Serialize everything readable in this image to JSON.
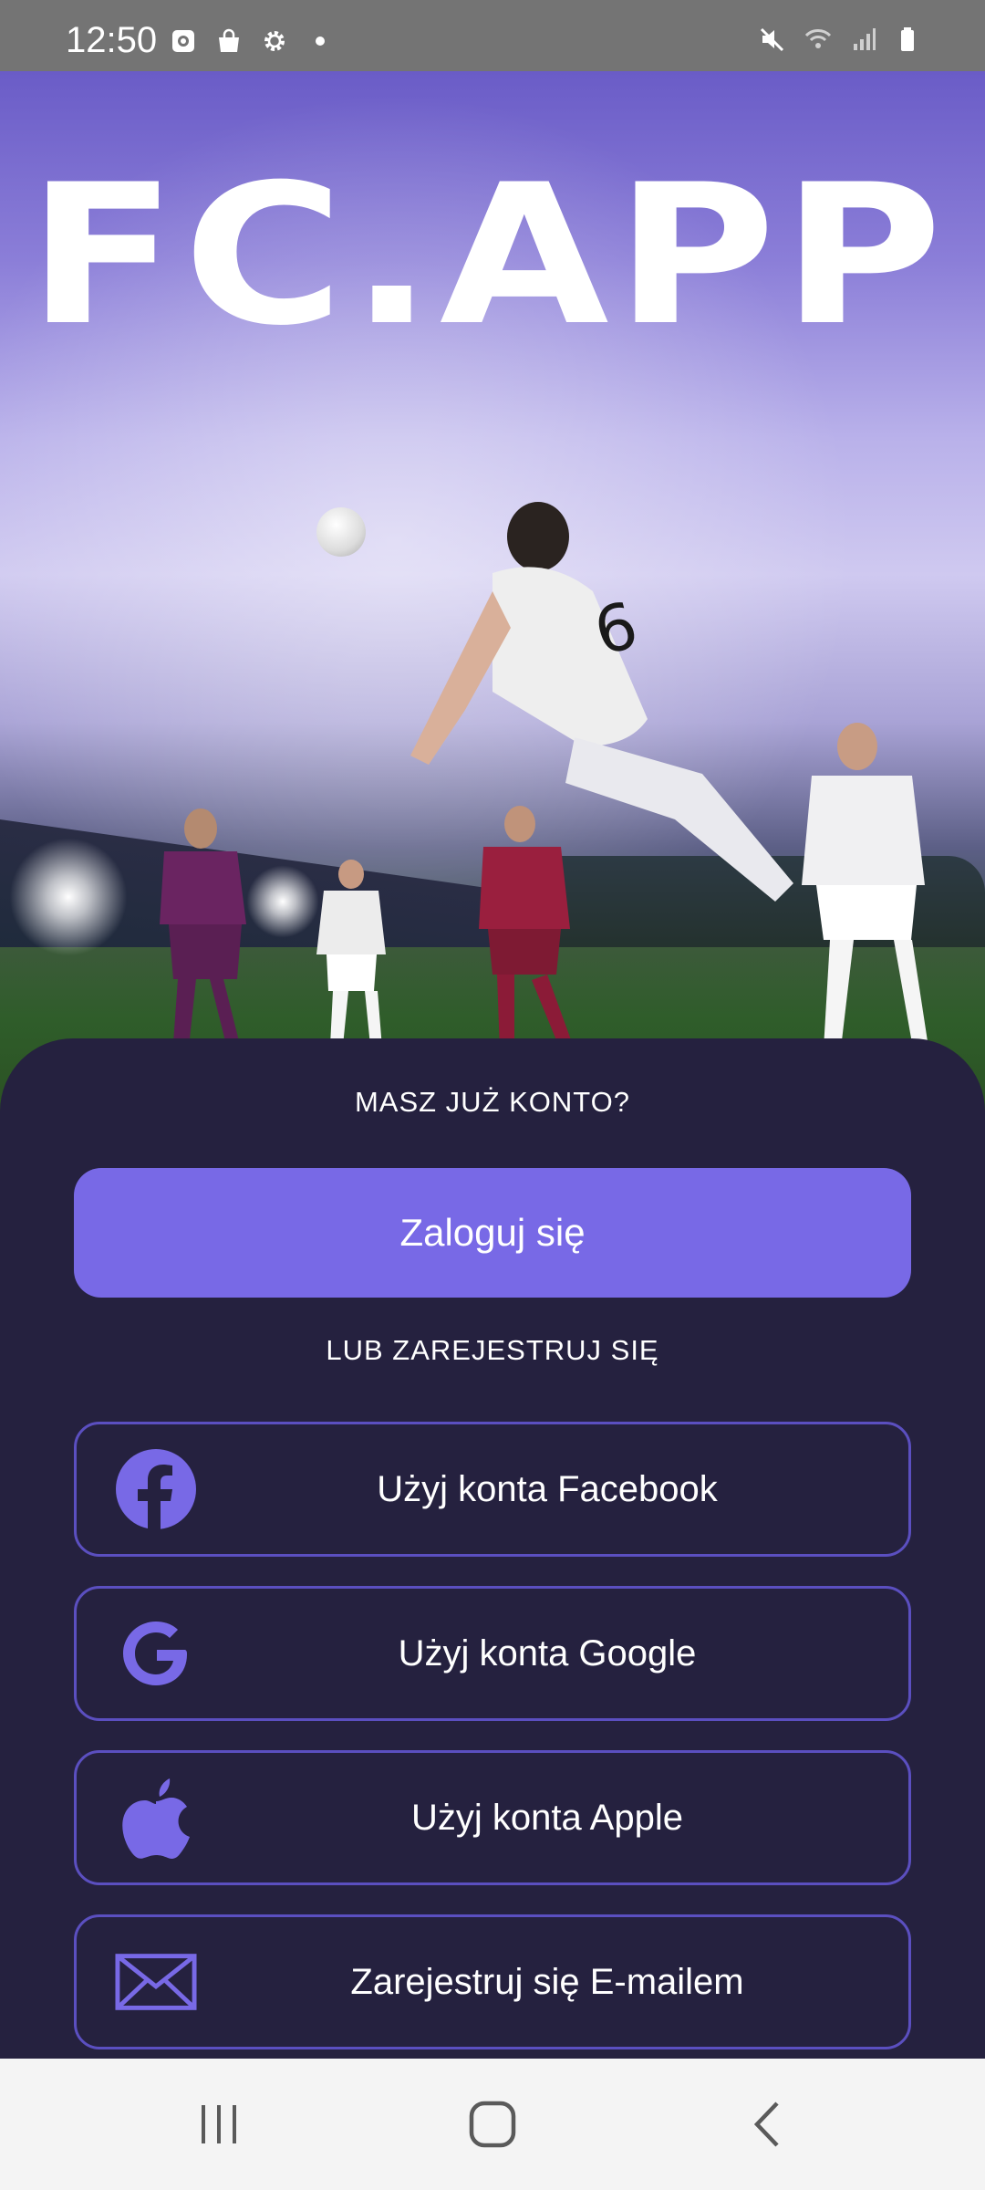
{
  "status_bar": {
    "time": "12:50",
    "left_icons": [
      "screenshot-icon",
      "bag-icon",
      "gear-icon",
      "dot-icon"
    ],
    "right_icons": [
      "mute-icon",
      "wifi-icon",
      "signal-icon",
      "battery-icon"
    ]
  },
  "hero": {
    "logo_text": "FC.APP"
  },
  "account": {
    "heading": "MASZ JUŻ KONTO?",
    "login_label": "Zaloguj się"
  },
  "register": {
    "heading": "LUB ZAREJESTRUJ SIĘ",
    "facebook_label": "Użyj konta Facebook",
    "google_label": "Użyj konta Google",
    "apple_label": "Użyj konta Apple",
    "email_label": "Zarejestruj się E-mailem"
  },
  "nav_bar": {
    "icons": [
      "recents-icon",
      "home-icon",
      "back-icon"
    ]
  },
  "colors": {
    "accent": "#7869e6",
    "sheet_background": "#25213f",
    "button_border": "#5b4fc0",
    "status_bar": "#747474",
    "nav_bar": "#f4f4f4"
  }
}
